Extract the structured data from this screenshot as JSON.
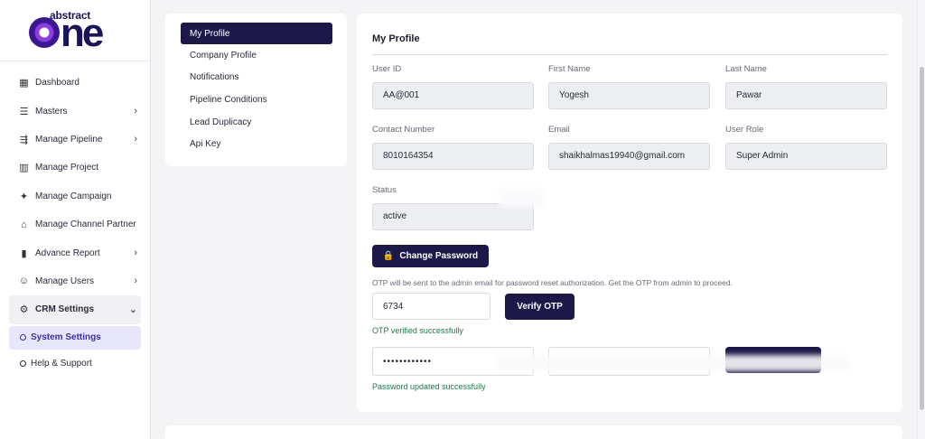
{
  "brand": {
    "top": "abstract",
    "bottom": "ne"
  },
  "sidebar": {
    "items": [
      {
        "label": "Dashboard",
        "icon": "dashboard-icon",
        "glyph": "▦",
        "chevron": ""
      },
      {
        "label": "Masters",
        "icon": "list-icon",
        "glyph": "☰",
        "chevron": "›"
      },
      {
        "label": "Manage Pipeline",
        "icon": "pipeline-icon",
        "glyph": "⇶",
        "chevron": "›"
      },
      {
        "label": "Manage Project",
        "icon": "building-icon",
        "glyph": "▥",
        "chevron": ""
      },
      {
        "label": "Manage Campaign",
        "icon": "megaphone-icon",
        "glyph": "✦",
        "chevron": ""
      },
      {
        "label": "Manage Channel Partner",
        "icon": "partner-icon",
        "glyph": "⌂",
        "chevron": ""
      },
      {
        "label": "Advance Report",
        "icon": "bar-chart-icon",
        "glyph": "▮",
        "chevron": "›"
      },
      {
        "label": "Manage Users",
        "icon": "users-icon",
        "glyph": "☺",
        "chevron": "›"
      }
    ],
    "crm": {
      "label": "CRM Settings",
      "glyph": "⚙",
      "chevron": "⌄"
    },
    "system_settings": "System Settings",
    "help": "Help & Support"
  },
  "settings_menu": [
    "My Profile",
    "Company Profile",
    "Notifications",
    "Pipeline Conditions",
    "Lead Duplicacy",
    "Api Key"
  ],
  "profile": {
    "title": "My Profile",
    "user_id": {
      "label": "User ID",
      "value": "AA@001"
    },
    "first_name": {
      "label": "First Name",
      "value": "Yogesh"
    },
    "last_name": {
      "label": "Last Name",
      "value": "Pawar"
    },
    "contact": {
      "label": "Contact Number",
      "value": "8010164354"
    },
    "email": {
      "label": "Email",
      "value": "shaikhalmas19940@gmail.com"
    },
    "role": {
      "label": "User Role",
      "value": "Super Admin"
    },
    "status": {
      "label": "Status",
      "value": "active"
    },
    "change_password": "Change Password",
    "otp_note": "OTP will be sent to the admin email for password reset authorization. Get the OTP from admin to proceed.",
    "otp_value": "6734",
    "verify_button": "Verify OTP",
    "otp_success": "OTP verified successfully",
    "password_value": "••••••••••••",
    "password_success": "Password updated successfully"
  },
  "colors": {
    "accent": "#1c1848",
    "success": "#1f7a4a",
    "active_bg": "#e8e6fb"
  }
}
